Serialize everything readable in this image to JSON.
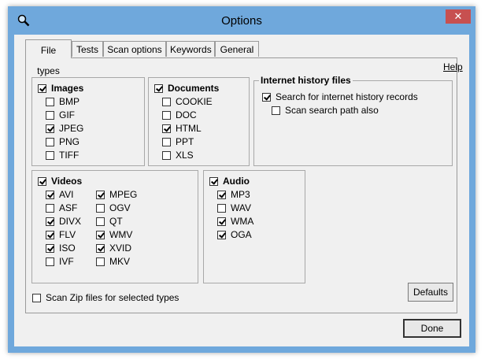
{
  "window": {
    "title": "Options",
    "close_glyph": "✕"
  },
  "tabs": [
    "File types",
    "Tests",
    "Scan options",
    "Keywords",
    "General"
  ],
  "help": "Help",
  "images": {
    "header": "Images",
    "checked": true,
    "items": [
      {
        "label": "BMP",
        "checked": false
      },
      {
        "label": "GIF",
        "checked": false
      },
      {
        "label": "JPEG",
        "checked": true
      },
      {
        "label": "PNG",
        "checked": false
      },
      {
        "label": "TIFF",
        "checked": false
      }
    ]
  },
  "documents": {
    "header": "Documents",
    "checked": true,
    "items": [
      {
        "label": "COOKIE",
        "checked": false
      },
      {
        "label": "DOC",
        "checked": false
      },
      {
        "label": "HTML",
        "checked": true
      },
      {
        "label": "PPT",
        "checked": false
      },
      {
        "label": "XLS",
        "checked": false
      }
    ]
  },
  "internet": {
    "header": "Internet history files",
    "items": [
      {
        "label": "Search for internet history records",
        "checked": true
      },
      {
        "label": "Scan search path also",
        "checked": false
      }
    ]
  },
  "videos": {
    "header": "Videos",
    "checked": true,
    "col1": [
      {
        "label": "AVI",
        "checked": true
      },
      {
        "label": "ASF",
        "checked": false
      },
      {
        "label": "DIVX",
        "checked": true
      },
      {
        "label": "FLV",
        "checked": true
      },
      {
        "label": "ISO",
        "checked": true
      },
      {
        "label": "IVF",
        "checked": false
      }
    ],
    "col2": [
      {
        "label": "MPEG",
        "checked": true
      },
      {
        "label": "OGV",
        "checked": false
      },
      {
        "label": "QT",
        "checked": false
      },
      {
        "label": "WMV",
        "checked": true
      },
      {
        "label": "XVID",
        "checked": true
      },
      {
        "label": "MKV",
        "checked": false
      }
    ]
  },
  "audio": {
    "header": "Audio",
    "checked": true,
    "items": [
      {
        "label": "MP3",
        "checked": true
      },
      {
        "label": "WAV",
        "checked": false
      },
      {
        "label": "WMA",
        "checked": true
      },
      {
        "label": "OGA",
        "checked": true
      }
    ]
  },
  "zip": {
    "label": "Scan Zip files for selected types",
    "checked": false
  },
  "buttons": {
    "defaults": "Defaults",
    "done": "Done"
  }
}
